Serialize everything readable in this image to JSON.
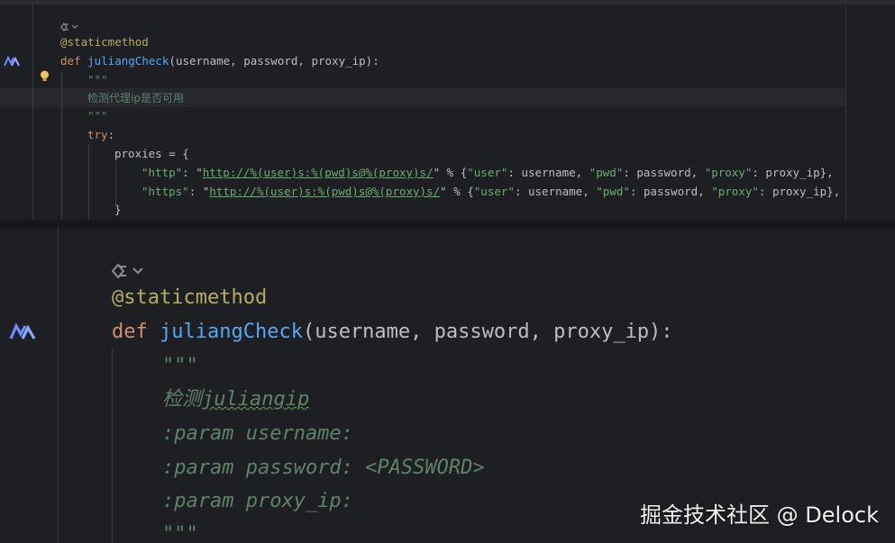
{
  "top_panel": {
    "lines": [
      {
        "id": "l1",
        "text": "@staticmethod"
      },
      {
        "id": "l2a",
        "text": "def"
      },
      {
        "id": "l2b",
        "text": "juliangCheck"
      },
      {
        "id": "l2c",
        "text": "(username, password, proxy_ip):"
      },
      {
        "id": "l3",
        "text": "\"\"\""
      },
      {
        "id": "l4",
        "text": "检测代理ip是否可用"
      },
      {
        "id": "l5",
        "text": "\"\"\""
      },
      {
        "id": "l6a",
        "text": "try"
      },
      {
        "id": "l6b",
        "text": ":"
      },
      {
        "id": "l7",
        "text": "proxies = {"
      },
      {
        "id": "l8a",
        "text": "\"http\""
      },
      {
        "id": "l8b",
        "text": ": \""
      },
      {
        "id": "l8c",
        "text": "http://%(user)s:%(pwd)s@%(proxy)s/"
      },
      {
        "id": "l8d",
        "text": "\" % {"
      },
      {
        "id": "l8e",
        "text": "\"user\""
      },
      {
        "id": "l8f",
        "text": ": username, "
      },
      {
        "id": "l8g",
        "text": "\"pwd\""
      },
      {
        "id": "l8h",
        "text": ": password, "
      },
      {
        "id": "l8i",
        "text": "\"proxy\""
      },
      {
        "id": "l8j",
        "text": ": proxy_ip},"
      },
      {
        "id": "l9a",
        "text": "\"https\""
      },
      {
        "id": "l9b",
        "text": ": \""
      },
      {
        "id": "l9c",
        "text": "http://%(user)s:%(pwd)s@%(proxy)s/"
      },
      {
        "id": "l9d",
        "text": "\" % {"
      },
      {
        "id": "l9e",
        "text": "\"user\""
      },
      {
        "id": "l9f",
        "text": ": username, "
      },
      {
        "id": "l9g",
        "text": "\"pwd\""
      },
      {
        "id": "l9h",
        "text": ": password, "
      },
      {
        "id": "l9i",
        "text": "\"proxy\""
      },
      {
        "id": "l9j",
        "text": ": proxy_ip},"
      },
      {
        "id": "l10",
        "text": "}"
      }
    ]
  },
  "bottom_panel": {
    "decorator": "@staticmethod",
    "def_kw": "def",
    "func_name": "juliangCheck",
    "params": "(username, password, proxy_ip):",
    "doc_open": "\"\"\"",
    "doc_prefix": "检测",
    "doc_word": "juliangip",
    "param1": ":param username:",
    "param2": ":param password: <PASSWORD>",
    "param3": ":param proxy_ip:",
    "doc_close": "\"\"\""
  },
  "watermark": "掘金技术社区 @ Delock",
  "icons": {
    "ai_assistant": "ai-assistant-icon",
    "hint": "lightbulb-icon",
    "inlay": "ai-inlay-icon"
  },
  "colors": {
    "background": "#1e1f22",
    "keyword": "#cf8e6d",
    "function": "#56a8f5",
    "decorator": "#b3ae60",
    "string": "#6aab73",
    "docstring": "#5f826b",
    "text": "#bcbec4"
  }
}
